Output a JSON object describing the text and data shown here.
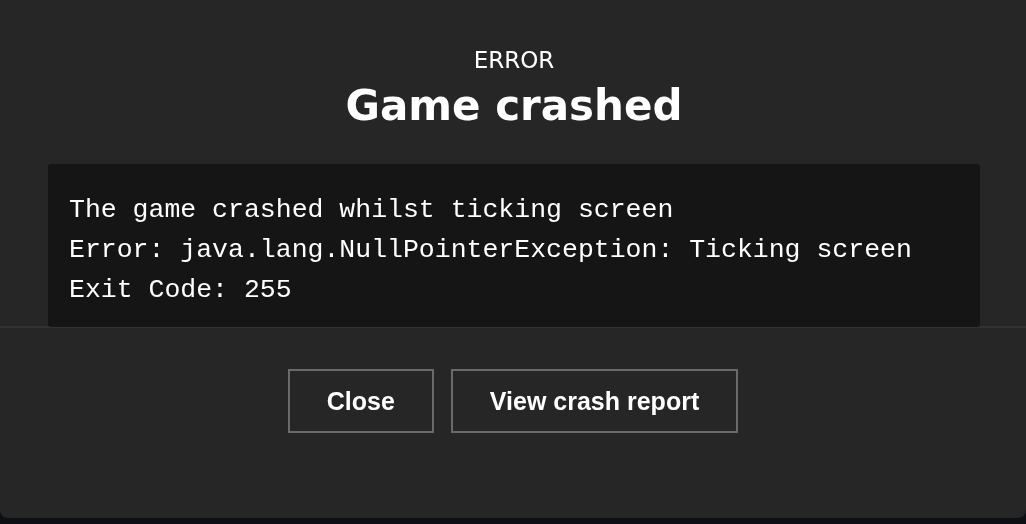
{
  "dialog": {
    "eyebrow": "ERROR",
    "title": "Game crashed",
    "log_lines": [
      "The game crashed whilst ticking screen",
      "Error: java.lang.NullPointerException: Ticking screen",
      "Exit Code: 255"
    ],
    "buttons": [
      {
        "label": "Close"
      },
      {
        "label": "View crash report"
      }
    ]
  }
}
